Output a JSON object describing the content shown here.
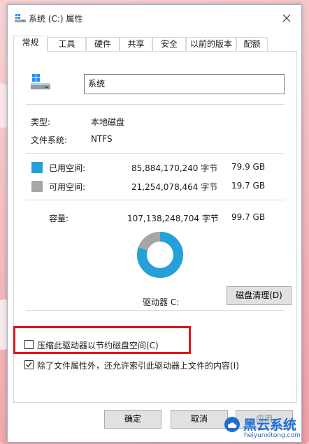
{
  "window": {
    "title": "系统 (C:) 属性"
  },
  "tabs": [
    "常规",
    "工具",
    "硬件",
    "共享",
    "安全",
    "以前的版本",
    "配额"
  ],
  "drive": {
    "name_value": "系统"
  },
  "info": {
    "type_label": "类型:",
    "type_value": "本地磁盘",
    "fs_label": "文件系统:",
    "fs_value": "NTFS"
  },
  "usage": {
    "used_label": "已用空间:",
    "used_bytes": "85,884,170,240 字节",
    "used_gb": "79.9 GB",
    "free_label": "可用空间:",
    "free_bytes": "21,254,078,464 字节",
    "free_gb": "19.7 GB",
    "capacity_label": "容量:",
    "capacity_bytes": "107,138,248,704 字节",
    "capacity_gb": "99.7 GB",
    "used_fraction": 0.8016,
    "used_color": "#26a0da",
    "free_color": "#a6a6a6"
  },
  "drive_label": "驱动器 C:",
  "cleanup_button": "磁盘清理(D)",
  "options": {
    "compress_label": "压缩此驱动器以节约磁盘空间(C)",
    "compress_checked": false,
    "index_label": "除了文件属性外，还允许索引此驱动器上文件的内容(I)",
    "index_checked": true
  },
  "buttons": {
    "ok": "确定",
    "cancel": "取消",
    "apply": "应用"
  },
  "watermark": {
    "brand": "黑云系统",
    "url": "heiyunxitong.com"
  }
}
